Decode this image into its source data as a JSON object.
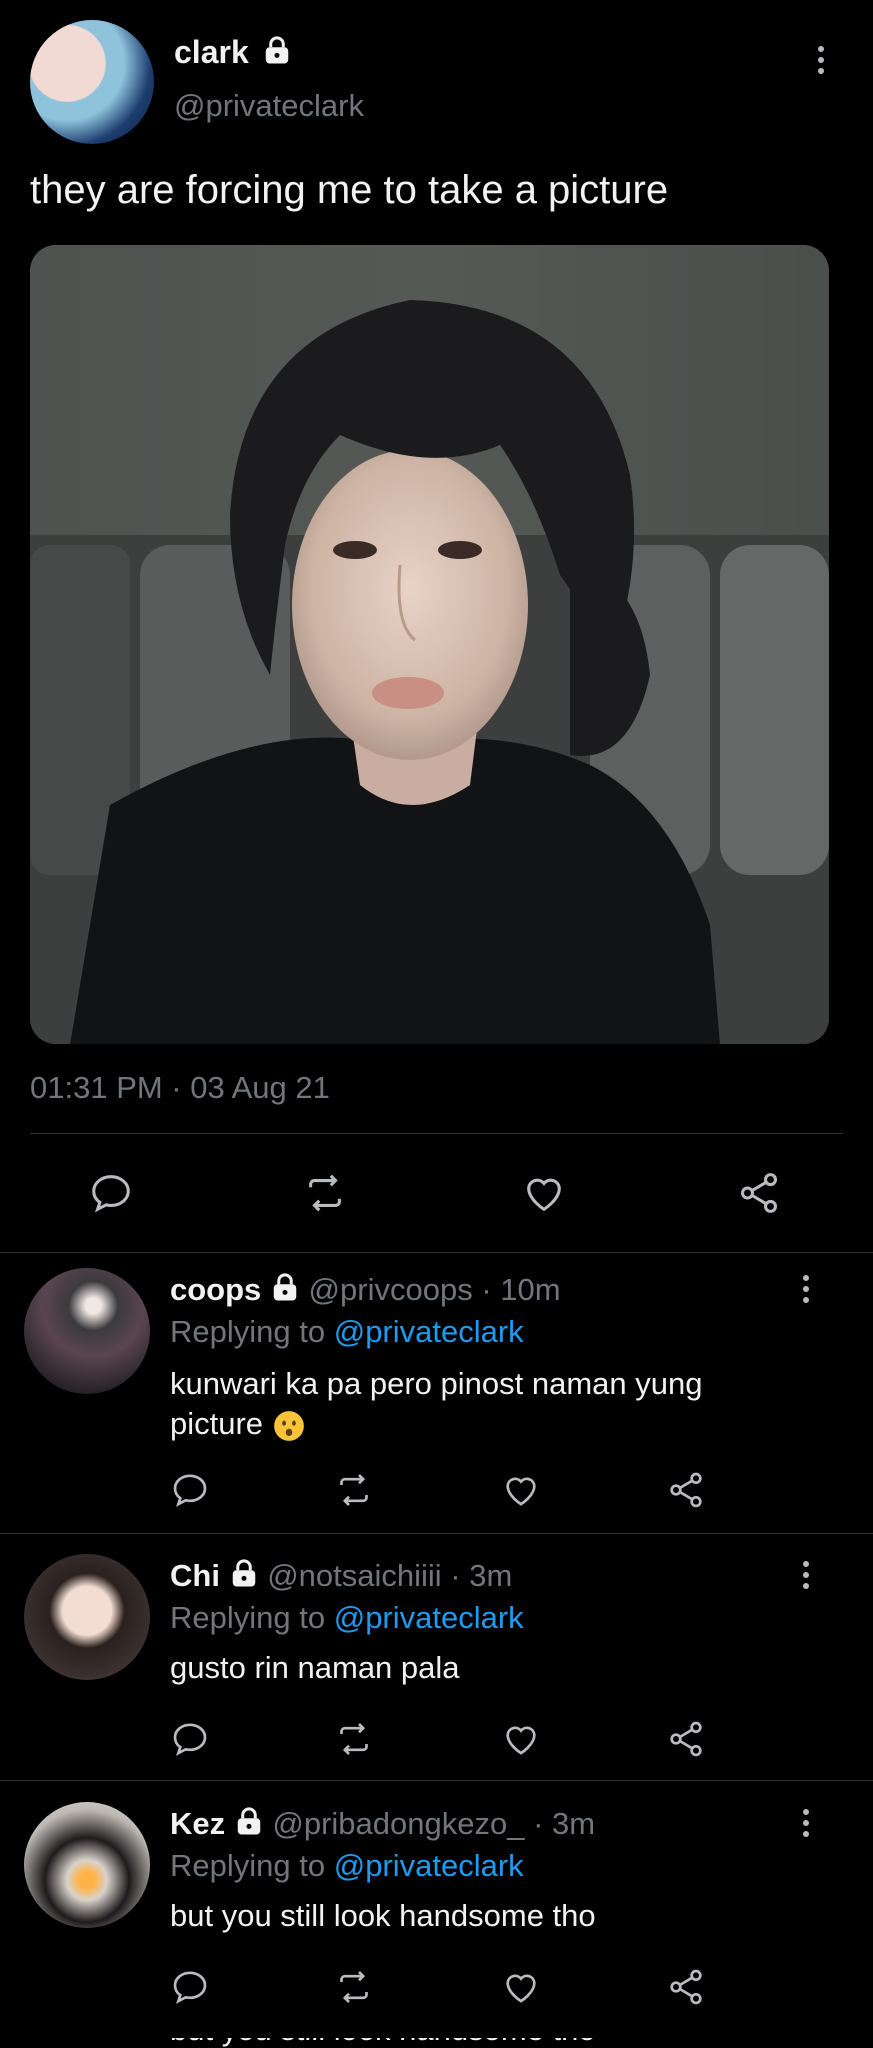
{
  "tweet": {
    "author_name": "clark",
    "author_handle": "@privateclark",
    "text": "they are forcing me to take a picture",
    "timestamp": "01:31 PM · 03 Aug 21",
    "actions": [
      "reply-icon",
      "retweet-icon",
      "like-icon",
      "share-icon"
    ]
  },
  "replies": [
    {
      "name": "coops",
      "handle": "@privcoops",
      "time": "· 10m",
      "replying_prefix": "Replying to",
      "replying_to": "@privateclark",
      "text_line1": "kunwari ka pa pero pinost naman yung",
      "text_line2": "picture"
    },
    {
      "name": "Chi",
      "handle": "@notsaichiiii",
      "time": "· 3m",
      "replying_prefix": "Replying to",
      "replying_to": "@privateclark",
      "text_line1": "gusto rin naman pala"
    },
    {
      "name": "Kez",
      "handle": "@pribadongkezo_",
      "time": "· 3m",
      "replying_prefix": "Replying to",
      "replying_to": "@privateclark",
      "text_line1": "but you still look handsome tho"
    }
  ],
  "colors": {
    "background": "#000000",
    "link": "#1d9bf0",
    "muted": "#71767b"
  }
}
